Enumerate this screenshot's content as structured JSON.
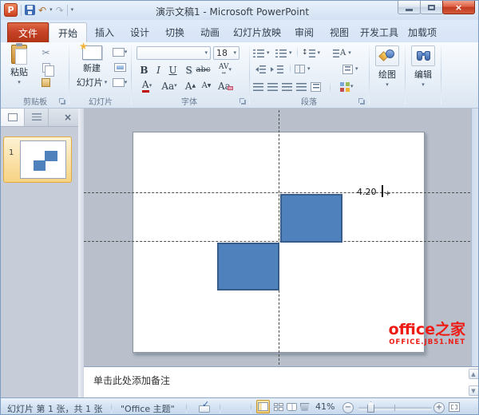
{
  "window": {
    "title": "演示文稿1 - Microsoft PowerPoint",
    "app_letter": "P"
  },
  "ribbon": {
    "tabs": [
      {
        "label": "文件"
      },
      {
        "label": "开始"
      },
      {
        "label": "插入"
      },
      {
        "label": "设计"
      },
      {
        "label": "切换"
      },
      {
        "label": "动画"
      },
      {
        "label": "幻灯片放映"
      },
      {
        "label": "审阅"
      },
      {
        "label": "视图"
      },
      {
        "label": "开发工具"
      },
      {
        "label": "加载项"
      }
    ],
    "clipboard": {
      "label": "剪贴板",
      "paste": "粘贴"
    },
    "slides": {
      "label": "幻灯片",
      "new_slide_line1": "新建",
      "new_slide_line2": "幻灯片"
    },
    "font": {
      "label": "字体",
      "size": "18"
    },
    "paragraph": {
      "label": "段落"
    },
    "drawing": {
      "label": "绘图"
    },
    "editing": {
      "label": "编辑"
    }
  },
  "icons": {
    "dropdown": "▾",
    "undo": "↶",
    "redo": "↷",
    "close": "×",
    "help": "?",
    "collapse_ribbon": "∧",
    "cut": "✂",
    "bold": "B",
    "italic": "I",
    "underline": "U",
    "shadow": "S",
    "strikethrough": "abc",
    "char_spacing": "AV",
    "left_right": "↔",
    "font_color": "A",
    "change_case": "Aa",
    "grow_font": "A",
    "shrink_font": "A",
    "clear_format": "Aa",
    "updown": "↕",
    "letter_a": "A",
    "panel_close": "×",
    "scroll_up": "▲",
    "scroll_down": "▼",
    "spell_check": "✓",
    "zoom_out": "−",
    "zoom_in": "+",
    "guide_plus": "+"
  },
  "slide_panel": {
    "slide_number": "1"
  },
  "canvas": {
    "guide_label": "4.20",
    "watermark_title": "office之家",
    "watermark_sub": "OFFICE.JB51.NET"
  },
  "notes": {
    "placeholder": "单击此处添加备注"
  },
  "status_bar": {
    "slide_info": "幻灯片 第 1 张，共 1 张",
    "theme": "\"Office 主题\"",
    "zoom_level": "41%"
  },
  "colors": {
    "shape_fill": "#4f81bd",
    "shape_border": "#385d8a",
    "file_tab_red": "#c64228",
    "watermark_red": "#ee1a14",
    "thumb_selection_orange": "#f7d382"
  }
}
